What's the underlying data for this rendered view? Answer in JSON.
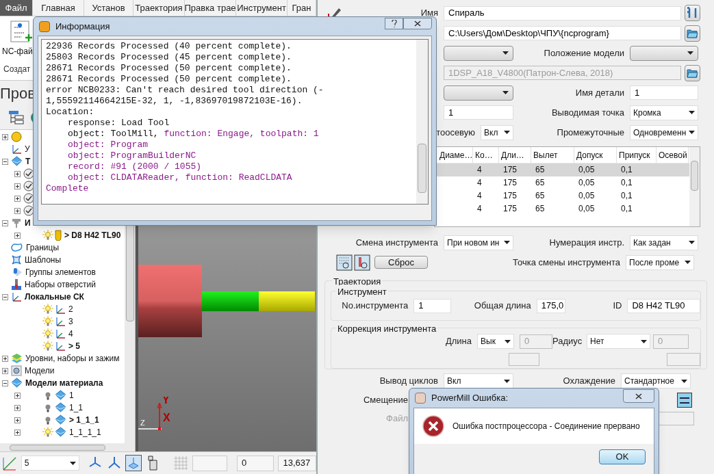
{
  "ribbon": {
    "tabs": [
      {
        "label": "Файл",
        "kind": "file"
      },
      {
        "label": "Главная",
        "kind": "tab"
      },
      {
        "label": "Установ",
        "kind": "tab"
      },
      {
        "label": "Траектория",
        "kind": "tab"
      },
      {
        "label": "Правка трае",
        "kind": "tab"
      },
      {
        "label": "Инструмент",
        "kind": "tab"
      },
      {
        "label": "Гран",
        "kind": "tab"
      }
    ],
    "button": "NC-фай",
    "group_label": "Создат"
  },
  "explorer": {
    "title": "Пров",
    "tree": [
      {
        "kind": "badge",
        "expanded": false
      },
      {
        "kind": "axes",
        "label": "У"
      },
      {
        "kind": "toolpaths",
        "label": "Т",
        "active": true,
        "expanded": true,
        "children": [
          {
            "kind": "check",
            "expanded": false
          },
          {
            "kind": "check",
            "expanded": false
          },
          {
            "kind": "check",
            "expanded": false
          },
          {
            "kind": "check",
            "expanded": false
          }
        ]
      },
      {
        "kind": "tools",
        "label": "И",
        "active": true,
        "expanded": true,
        "children": [
          {
            "kind": "tool",
            "label": "> D8 H42 TL90",
            "active": true,
            "lit": true,
            "expanded": false
          }
        ]
      },
      {
        "kind": "boundary",
        "label": "Границы"
      },
      {
        "kind": "pattern",
        "label": "Шаблоны"
      },
      {
        "kind": "feature",
        "label": "Группы элементов"
      },
      {
        "kind": "holes",
        "label": "Наборы отверстий"
      },
      {
        "kind": "workplane",
        "label": "Локальные СК",
        "active": true,
        "expanded": true,
        "children": [
          {
            "kind": "workplane",
            "label": "2",
            "lit": true
          },
          {
            "kind": "workplane",
            "label": "3",
            "lit": true
          },
          {
            "kind": "workplane",
            "label": "4",
            "lit": true
          },
          {
            "kind": "workplane",
            "label": "> 5",
            "lit": true,
            "active": true
          }
        ]
      },
      {
        "kind": "layers",
        "label": "Уровни, наборы и зажим",
        "expanded": false
      },
      {
        "kind": "model",
        "label": "Модели",
        "expanded": false
      },
      {
        "kind": "stock",
        "label": "Модели материала",
        "active": true,
        "expanded": true,
        "children": [
          {
            "kind": "stock",
            "label": "1",
            "lit": false,
            "expanded": false
          },
          {
            "kind": "stock",
            "label": "1_1",
            "lit": false,
            "expanded": false
          },
          {
            "kind": "stock",
            "label": "> 1_1_1",
            "lit": false,
            "active": true,
            "expanded": false
          },
          {
            "kind": "stock",
            "label": "1_1_1_1",
            "lit": true,
            "expanded": false
          }
        ]
      }
    ]
  },
  "viewport": {
    "axes": {
      "y": "Y",
      "x": "X",
      "z": "Z"
    }
  },
  "status_bar": {
    "workplane": "5",
    "fields": [
      "0",
      "13,637"
    ]
  },
  "program_dialog": {
    "name_label": "Имя",
    "name": "Спираль",
    "path": "C:\\Users\\Дом\\Desktop\\ЧПУ\\{ncprogram}",
    "model_position_label": "Положение модели",
    "machine": "1DSP_A18_V4800(Патрон-Слева, 2018)",
    "part_name_label": "Имя детали",
    "part_name": "1",
    "number": "1",
    "output_point_label": "Выводимая точка",
    "output_point": "Кромка",
    "axial_label": "тоосевую",
    "axial": "Вкл",
    "intermediate_label": "Промежуточные",
    "intermediate": "Одновременн",
    "table": {
      "columns": [
        "Диаме…",
        "Ко…",
        "Дли…",
        "Вылет",
        "Допуск",
        "Припуск",
        "Осевой"
      ],
      "rows": [
        {
          "selected": true,
          "cells": [
            "",
            "4",
            "175",
            "65",
            "0,05",
            "0,1"
          ]
        },
        {
          "selected": false,
          "cells": [
            "",
            "4",
            "175",
            "65",
            "0,05",
            "0,1"
          ]
        },
        {
          "selected": false,
          "cells": [
            "",
            "4",
            "175",
            "65",
            "0,05",
            "0,1"
          ]
        },
        {
          "selected": false,
          "cells": [
            "",
            "4",
            "175",
            "65",
            "0,05",
            "0,1"
          ]
        }
      ]
    },
    "tool_change_label": "Смена инструмента",
    "tool_change": "При новом ин",
    "numbering_label": "Нумерация инстр.",
    "numbering": "Как задан",
    "reset_button": "Сброс",
    "change_point_label": "Точка смены инструмента",
    "change_point": "После проме",
    "toolpath_group": "Траектория",
    "tool_group": "Инструмент",
    "tool_number_label": "No.инструмента",
    "tool_number": "1",
    "total_length_label": "Общая длина",
    "total_length": "175,0",
    "id_label": "ID",
    "id": "D8 H42 TL90",
    "compensation_group": "Коррекция инструмента",
    "length_label": "Длина",
    "length": "Вык",
    "length_value": "0",
    "radius_label": "Радиус",
    "radius": "Нет",
    "radius_value": "0",
    "cycles_label": "Вывод циклов",
    "cycles": "Вкл",
    "coolant_label": "Охлаждение",
    "coolant": "Стандартное",
    "offset_label": "Смещение",
    "file_label": "Файл"
  },
  "info_window": {
    "title": "Информация",
    "lines": [
      {
        "indent": false,
        "segments": [
          {
            "text": "22936 Records Processed (40 percent complete).",
            "highlight": false
          }
        ]
      },
      {
        "indent": false,
        "segments": [
          {
            "text": "25803 Records Processed (45 percent complete).",
            "highlight": false
          }
        ]
      },
      {
        "indent": false,
        "segments": [
          {
            "text": "28671 Records Processed (50 percent complete).",
            "highlight": false
          }
        ]
      },
      {
        "indent": false,
        "segments": [
          {
            "text": "28671 Records Processed (50 percent complete).",
            "highlight": false
          }
        ]
      },
      {
        "indent": false,
        "segments": [
          {
            "text": "error NCB0233: Can't reach desired tool direction (-",
            "highlight": false
          }
        ]
      },
      {
        "indent": false,
        "segments": [
          {
            "text": "1,55592114664215E-32, 1, -1,83697019872103E-16).",
            "highlight": false
          }
        ]
      },
      {
        "indent": false,
        "segments": [
          {
            "text": "Location:",
            "highlight": false
          }
        ]
      },
      {
        "indent": true,
        "segments": [
          {
            "text": "response: Load Tool",
            "highlight": false
          }
        ]
      },
      {
        "indent": true,
        "segments": [
          {
            "text": "object: ToolMill,",
            "highlight": false
          },
          {
            "text": "function: Engage, toolpath: 1",
            "highlight": true
          }
        ]
      },
      {
        "indent": true,
        "segments": [
          {
            "text": "object: Program",
            "highlight": true
          }
        ]
      },
      {
        "indent": true,
        "segments": [
          {
            "text": "object: ProgramBuilderNC",
            "highlight": true
          }
        ]
      },
      {
        "indent": true,
        "segments": [
          {
            "text": "record: #91 (2000 / 1055)",
            "highlight": true
          }
        ]
      },
      {
        "indent": true,
        "segments": [
          {
            "text": "object: CLDATAReader, function: ReadCLDATA",
            "highlight": true
          }
        ]
      },
      {
        "indent": false,
        "segments": [
          {
            "text": "Complete",
            "highlight": true
          }
        ]
      }
    ]
  },
  "error_dialog": {
    "title": "PowerMill Ошибка:",
    "message": "Ошибка постпроцессора - Соединение прервано",
    "button": "OK"
  }
}
